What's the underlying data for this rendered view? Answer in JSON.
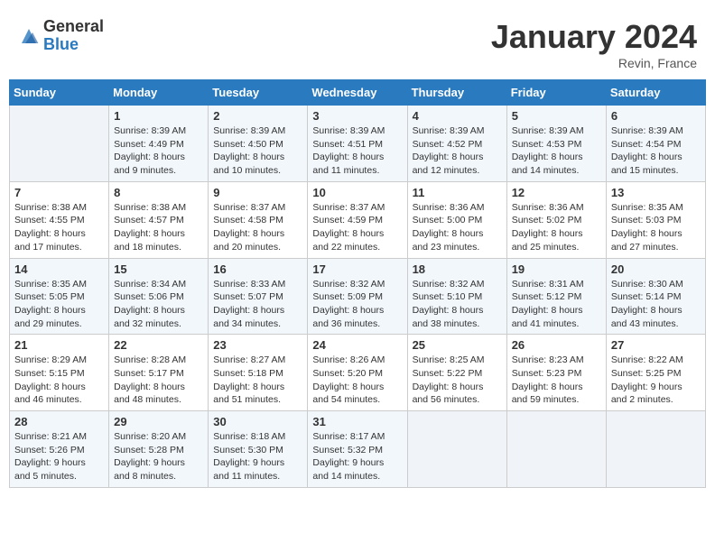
{
  "header": {
    "logo_general": "General",
    "logo_blue": "Blue",
    "month_title": "January 2024",
    "location": "Revin, France"
  },
  "weekdays": [
    "Sunday",
    "Monday",
    "Tuesday",
    "Wednesday",
    "Thursday",
    "Friday",
    "Saturday"
  ],
  "weeks": [
    [
      {
        "day": "",
        "sunrise": "",
        "sunset": "",
        "daylight": ""
      },
      {
        "day": "1",
        "sunrise": "Sunrise: 8:39 AM",
        "sunset": "Sunset: 4:49 PM",
        "daylight": "Daylight: 8 hours and 9 minutes."
      },
      {
        "day": "2",
        "sunrise": "Sunrise: 8:39 AM",
        "sunset": "Sunset: 4:50 PM",
        "daylight": "Daylight: 8 hours and 10 minutes."
      },
      {
        "day": "3",
        "sunrise": "Sunrise: 8:39 AM",
        "sunset": "Sunset: 4:51 PM",
        "daylight": "Daylight: 8 hours and 11 minutes."
      },
      {
        "day": "4",
        "sunrise": "Sunrise: 8:39 AM",
        "sunset": "Sunset: 4:52 PM",
        "daylight": "Daylight: 8 hours and 12 minutes."
      },
      {
        "day": "5",
        "sunrise": "Sunrise: 8:39 AM",
        "sunset": "Sunset: 4:53 PM",
        "daylight": "Daylight: 8 hours and 14 minutes."
      },
      {
        "day": "6",
        "sunrise": "Sunrise: 8:39 AM",
        "sunset": "Sunset: 4:54 PM",
        "daylight": "Daylight: 8 hours and 15 minutes."
      }
    ],
    [
      {
        "day": "7",
        "sunrise": "Sunrise: 8:38 AM",
        "sunset": "Sunset: 4:55 PM",
        "daylight": "Daylight: 8 hours and 17 minutes."
      },
      {
        "day": "8",
        "sunrise": "Sunrise: 8:38 AM",
        "sunset": "Sunset: 4:57 PM",
        "daylight": "Daylight: 8 hours and 18 minutes."
      },
      {
        "day": "9",
        "sunrise": "Sunrise: 8:37 AM",
        "sunset": "Sunset: 4:58 PM",
        "daylight": "Daylight: 8 hours and 20 minutes."
      },
      {
        "day": "10",
        "sunrise": "Sunrise: 8:37 AM",
        "sunset": "Sunset: 4:59 PM",
        "daylight": "Daylight: 8 hours and 22 minutes."
      },
      {
        "day": "11",
        "sunrise": "Sunrise: 8:36 AM",
        "sunset": "Sunset: 5:00 PM",
        "daylight": "Daylight: 8 hours and 23 minutes."
      },
      {
        "day": "12",
        "sunrise": "Sunrise: 8:36 AM",
        "sunset": "Sunset: 5:02 PM",
        "daylight": "Daylight: 8 hours and 25 minutes."
      },
      {
        "day": "13",
        "sunrise": "Sunrise: 8:35 AM",
        "sunset": "Sunset: 5:03 PM",
        "daylight": "Daylight: 8 hours and 27 minutes."
      }
    ],
    [
      {
        "day": "14",
        "sunrise": "Sunrise: 8:35 AM",
        "sunset": "Sunset: 5:05 PM",
        "daylight": "Daylight: 8 hours and 29 minutes."
      },
      {
        "day": "15",
        "sunrise": "Sunrise: 8:34 AM",
        "sunset": "Sunset: 5:06 PM",
        "daylight": "Daylight: 8 hours and 32 minutes."
      },
      {
        "day": "16",
        "sunrise": "Sunrise: 8:33 AM",
        "sunset": "Sunset: 5:07 PM",
        "daylight": "Daylight: 8 hours and 34 minutes."
      },
      {
        "day": "17",
        "sunrise": "Sunrise: 8:32 AM",
        "sunset": "Sunset: 5:09 PM",
        "daylight": "Daylight: 8 hours and 36 minutes."
      },
      {
        "day": "18",
        "sunrise": "Sunrise: 8:32 AM",
        "sunset": "Sunset: 5:10 PM",
        "daylight": "Daylight: 8 hours and 38 minutes."
      },
      {
        "day": "19",
        "sunrise": "Sunrise: 8:31 AM",
        "sunset": "Sunset: 5:12 PM",
        "daylight": "Daylight: 8 hours and 41 minutes."
      },
      {
        "day": "20",
        "sunrise": "Sunrise: 8:30 AM",
        "sunset": "Sunset: 5:14 PM",
        "daylight": "Daylight: 8 hours and 43 minutes."
      }
    ],
    [
      {
        "day": "21",
        "sunrise": "Sunrise: 8:29 AM",
        "sunset": "Sunset: 5:15 PM",
        "daylight": "Daylight: 8 hours and 46 minutes."
      },
      {
        "day": "22",
        "sunrise": "Sunrise: 8:28 AM",
        "sunset": "Sunset: 5:17 PM",
        "daylight": "Daylight: 8 hours and 48 minutes."
      },
      {
        "day": "23",
        "sunrise": "Sunrise: 8:27 AM",
        "sunset": "Sunset: 5:18 PM",
        "daylight": "Daylight: 8 hours and 51 minutes."
      },
      {
        "day": "24",
        "sunrise": "Sunrise: 8:26 AM",
        "sunset": "Sunset: 5:20 PM",
        "daylight": "Daylight: 8 hours and 54 minutes."
      },
      {
        "day": "25",
        "sunrise": "Sunrise: 8:25 AM",
        "sunset": "Sunset: 5:22 PM",
        "daylight": "Daylight: 8 hours and 56 minutes."
      },
      {
        "day": "26",
        "sunrise": "Sunrise: 8:23 AM",
        "sunset": "Sunset: 5:23 PM",
        "daylight": "Daylight: 8 hours and 59 minutes."
      },
      {
        "day": "27",
        "sunrise": "Sunrise: 8:22 AM",
        "sunset": "Sunset: 5:25 PM",
        "daylight": "Daylight: 9 hours and 2 minutes."
      }
    ],
    [
      {
        "day": "28",
        "sunrise": "Sunrise: 8:21 AM",
        "sunset": "Sunset: 5:26 PM",
        "daylight": "Daylight: 9 hours and 5 minutes."
      },
      {
        "day": "29",
        "sunrise": "Sunrise: 8:20 AM",
        "sunset": "Sunset: 5:28 PM",
        "daylight": "Daylight: 9 hours and 8 minutes."
      },
      {
        "day": "30",
        "sunrise": "Sunrise: 8:18 AM",
        "sunset": "Sunset: 5:30 PM",
        "daylight": "Daylight: 9 hours and 11 minutes."
      },
      {
        "day": "31",
        "sunrise": "Sunrise: 8:17 AM",
        "sunset": "Sunset: 5:32 PM",
        "daylight": "Daylight: 9 hours and 14 minutes."
      },
      {
        "day": "",
        "sunrise": "",
        "sunset": "",
        "daylight": ""
      },
      {
        "day": "",
        "sunrise": "",
        "sunset": "",
        "daylight": ""
      },
      {
        "day": "",
        "sunrise": "",
        "sunset": "",
        "daylight": ""
      }
    ]
  ]
}
